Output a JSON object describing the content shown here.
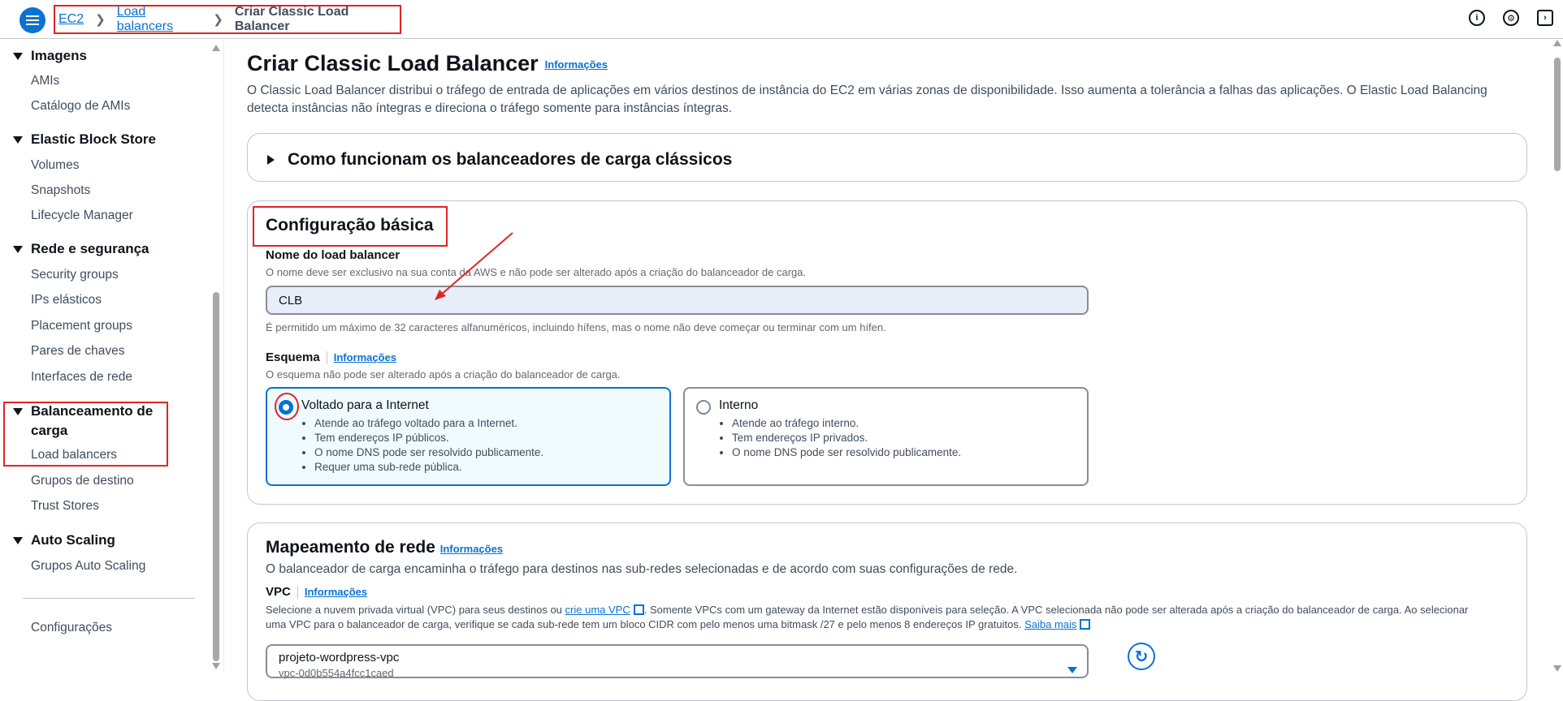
{
  "topbar": {
    "breadcrumb": {
      "ec2": "EC2",
      "load_balancers": "Load balancers",
      "current": "Criar Classic Load Balancer"
    },
    "icons": [
      "info-icon",
      "settings-icon",
      "cloudshell-icon"
    ]
  },
  "sidebar": {
    "sections": [
      {
        "label": "Imagens",
        "items": [
          "AMIs",
          "Catálogo de AMIs"
        ]
      },
      {
        "label": "Elastic Block Store",
        "items": [
          "Volumes",
          "Snapshots",
          "Lifecycle Manager"
        ]
      },
      {
        "label": "Rede e segurança",
        "items": [
          "Security groups",
          "IPs elásticos",
          "Placement groups",
          "Pares de chaves",
          "Interfaces de rede"
        ]
      },
      {
        "label": "Balanceamento de carga",
        "line1": "Balanceamento de",
        "line2": "carga",
        "items": [
          "Load balancers",
          "Grupos de destino",
          "Trust Stores"
        ]
      },
      {
        "label": "Auto Scaling",
        "items": [
          "Grupos Auto Scaling"
        ]
      }
    ],
    "footer": "Configurações"
  },
  "page": {
    "title": "Criar Classic Load Balancer",
    "info": "Informações",
    "description": "O Classic Load Balancer distribui o tráfego de entrada de aplicações em vários destinos de instância do EC2 em várias zonas de disponibilidade. Isso aumenta a tolerância a falhas das aplicações. O Elastic Load Balancing detecta instâncias não íntegras e direciona o tráfego somente para instâncias íntegras.",
    "how_it_works": "Como funcionam os balanceadores de carga clássicos"
  },
  "basic": {
    "title": "Configuração básica",
    "name_label": "Nome do load balancer",
    "name_hint": "O nome deve ser exclusivo na sua conta da AWS e não pode ser alterado após a criação do balanceador de carga.",
    "name_value": "CLB",
    "name_constraint": "É permitido um máximo de 32 caracteres alfanuméricos, incluindo hífens, mas o nome não deve começar ou terminar com um hífen.",
    "scheme_label": "Esquema",
    "scheme_info": "Informações",
    "scheme_hint": "O esquema não pode ser alterado após a criação do balanceador de carga.",
    "options": [
      {
        "title": "Voltado para a Internet",
        "selected": true,
        "bullets": [
          "Atende ao tráfego voltado para a Internet.",
          "Tem endereços IP públicos.",
          "O nome DNS pode ser resolvido publicamente.",
          "Requer uma sub-rede pública."
        ]
      },
      {
        "title": "Interno",
        "selected": false,
        "bullets": [
          "Atende ao tráfego interno.",
          "Tem endereços IP privados.",
          "O nome DNS pode ser resolvido publicamente."
        ]
      }
    ]
  },
  "network": {
    "title": "Mapeamento de rede",
    "info": "Informações",
    "desc": "O balanceador de carga encaminha o tráfego para destinos nas sub-redes selecionadas e de acordo com suas configurações de rede.",
    "vpc_label": "VPC",
    "vpc_info": "Informações",
    "vpc_hint_1": "Selecione a nuvem privada virtual (VPC) para seus destinos ou",
    "vpc_link": "crie uma VPC",
    "vpc_hint_2": ". Somente VPCs com um gateway da Internet estão disponíveis para seleção. A VPC selecionada não pode ser alterada após a criação do balanceador de carga. Ao selecionar uma VPC para o balanceador de carga, verifique se cada sub-rede tem um bloco CIDR com pelo menos uma bitmask /27 e pelo menos 8 endereços IP gratuitos.",
    "learn_more": "Saiba mais",
    "vpc_value": "projeto-wordpress-vpc",
    "vpc_id": "vpc-0d0b554a4fcc1caed"
  },
  "colors": {
    "accent": "#0972d3",
    "annotation": "#e02424"
  }
}
